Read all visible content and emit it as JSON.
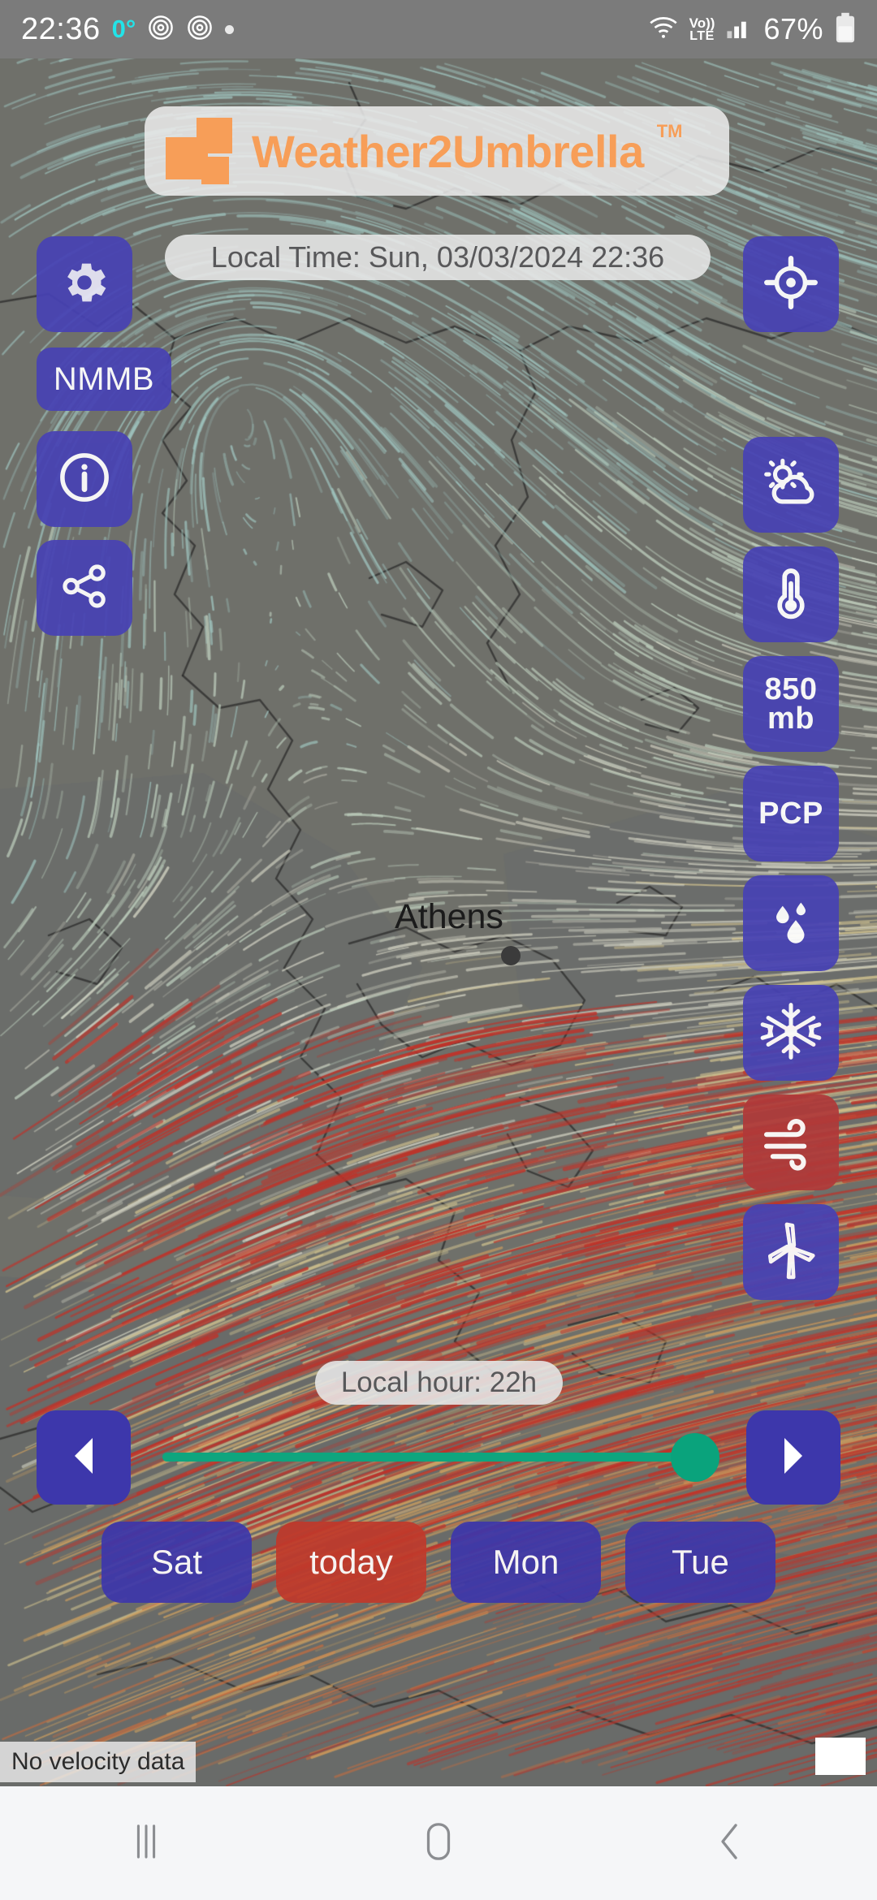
{
  "status_bar": {
    "time": "22:36",
    "temperature": "0°",
    "battery_percent": "67%",
    "volte_label": "Vo))",
    "volte_sub": "LTE",
    "icons": [
      "fingerprint-icon",
      "fingerprint-icon",
      "dot-indicator",
      "wifi-icon",
      "volte-icon",
      "cellular-signal-icon",
      "battery-icon"
    ]
  },
  "header": {
    "app_name": "Weather2Umbrella",
    "trademark": "TM",
    "logo_icon": "squares-logo-icon",
    "brand_color": "#f79e58"
  },
  "local_time": {
    "text": "Local Time: Sun, 03/03/2024 22:36"
  },
  "left_controls": [
    {
      "name": "settings-button",
      "icon": "gear-icon",
      "label": ""
    },
    {
      "name": "model-button",
      "icon": "",
      "label": "NMMB"
    },
    {
      "name": "info-button",
      "icon": "info-circle-icon",
      "label": ""
    },
    {
      "name": "share-button",
      "icon": "share-nodes-icon",
      "label": ""
    }
  ],
  "right_controls": [
    {
      "name": "locate-button",
      "icon": "crosshair-location-icon",
      "label": "",
      "active": false
    },
    {
      "name": "clouds-layer-button",
      "icon": "sun-cloud-icon",
      "label": "",
      "active": false
    },
    {
      "name": "temperature-layer-button",
      "icon": "thermometer-icon",
      "label": "",
      "active": false
    },
    {
      "name": "pressure-850mb-button",
      "icon": "",
      "label": "850 mb",
      "label_line1": "850",
      "label_line2": "mb",
      "active": false
    },
    {
      "name": "precipitation-button",
      "icon": "",
      "label": "PCP",
      "active": false
    },
    {
      "name": "rain-layer-button",
      "icon": "raindrops-icon",
      "label": "",
      "active": false
    },
    {
      "name": "snow-layer-button",
      "icon": "snowflake-icon",
      "label": "",
      "active": false
    },
    {
      "name": "wind-layer-button",
      "icon": "wind-icon",
      "label": "",
      "active": true
    },
    {
      "name": "wind-turbine-button",
      "icon": "wind-turbine-icon",
      "label": "",
      "active": false
    }
  ],
  "map": {
    "city_label": "Athens",
    "marker": "city-dot",
    "no_data_notice": "No velocity data",
    "active_layer_color": "#b03a3a",
    "button_color": "#4842b4"
  },
  "timeline": {
    "local_hour": "Local hour: 22h",
    "prev_icon": "arrow-left-icon",
    "next_icon": "arrow-right-icon",
    "slider_value_percent": 100,
    "slider_color": "#0fa57e"
  },
  "days": [
    {
      "label": "Sat",
      "active": false
    },
    {
      "label": "today",
      "active": true
    },
    {
      "label": "Mon",
      "active": false
    },
    {
      "label": "Tue",
      "active": false
    }
  ],
  "nav_bar": {
    "recents": "recents-icon",
    "home": "home-icon",
    "back": "back-icon"
  }
}
